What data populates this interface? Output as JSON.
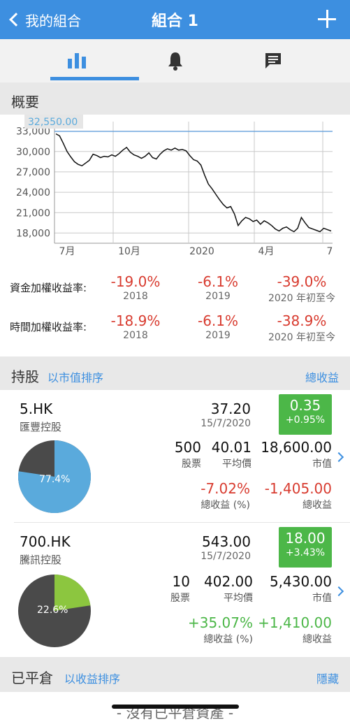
{
  "header": {
    "back_label": "我的組合",
    "title": "組合 1",
    "add_icon": "plus-icon",
    "background": "#3d8fe0"
  },
  "tabs": [
    {
      "icon": "bar-chart-icon",
      "active": true
    },
    {
      "icon": "bell-icon",
      "active": false
    },
    {
      "icon": "message-icon",
      "active": false
    }
  ],
  "overview": {
    "title": "概要"
  },
  "chart_data": {
    "type": "line",
    "title": "",
    "highlight_label": "32,550.00",
    "y_ticks": [
      "33,000",
      "30,000",
      "27,000",
      "24,000",
      "21,000",
      "18,000"
    ],
    "ylim": [
      16500,
      34400
    ],
    "x_ticks": [
      "7月",
      "10月",
      "2020",
      "4月",
      "7"
    ],
    "grid": true,
    "series": [
      {
        "points": [
          [
            0,
            32600
          ],
          [
            3,
            32300
          ],
          [
            6,
            31200
          ],
          [
            9,
            30000
          ],
          [
            12,
            29200
          ],
          [
            15,
            28500
          ],
          [
            18,
            28100
          ],
          [
            21,
            27900
          ],
          [
            24,
            28300
          ],
          [
            27,
            28700
          ],
          [
            30,
            29600
          ],
          [
            33,
            29400
          ],
          [
            36,
            29100
          ],
          [
            39,
            29300
          ],
          [
            42,
            29200
          ],
          [
            45,
            29500
          ],
          [
            48,
            29300
          ],
          [
            51,
            29700
          ],
          [
            54,
            30200
          ],
          [
            57,
            30600
          ],
          [
            60,
            29900
          ],
          [
            63,
            29500
          ],
          [
            66,
            29300
          ],
          [
            69,
            29000
          ],
          [
            72,
            29300
          ],
          [
            75,
            29800
          ],
          [
            78,
            29100
          ],
          [
            81,
            28900
          ],
          [
            84,
            29600
          ],
          [
            87,
            30100
          ],
          [
            90,
            30400
          ],
          [
            93,
            30200
          ],
          [
            96,
            30500
          ],
          [
            99,
            30200
          ],
          [
            102,
            30300
          ],
          [
            105,
            30100
          ],
          [
            108,
            29400
          ],
          [
            111,
            28800
          ],
          [
            114,
            28600
          ],
          [
            117,
            28000
          ],
          [
            120,
            26500
          ],
          [
            123,
            25200
          ],
          [
            126,
            24500
          ],
          [
            129,
            23700
          ],
          [
            132,
            22900
          ],
          [
            135,
            22200
          ],
          [
            138,
            21700
          ],
          [
            141,
            21900
          ],
          [
            144,
            20800
          ],
          [
            147,
            19100
          ],
          [
            150,
            19800
          ],
          [
            153,
            20300
          ],
          [
            156,
            20100
          ],
          [
            159,
            19700
          ],
          [
            162,
            19900
          ],
          [
            165,
            19300
          ],
          [
            168,
            19800
          ],
          [
            171,
            19500
          ],
          [
            174,
            19100
          ],
          [
            177,
            18600
          ],
          [
            180,
            18300
          ],
          [
            183,
            18700
          ],
          [
            186,
            18900
          ],
          [
            189,
            18500
          ],
          [
            192,
            18200
          ],
          [
            195,
            18700
          ],
          [
            198,
            20300
          ],
          [
            201,
            19500
          ],
          [
            204,
            18800
          ],
          [
            207,
            18600
          ],
          [
            210,
            18400
          ],
          [
            213,
            18200
          ],
          [
            216,
            18700
          ],
          [
            219,
            18500
          ],
          [
            222,
            18300
          ]
        ]
      }
    ]
  },
  "returns": {
    "rows": [
      {
        "label": "資金加權收益率:",
        "values": [
          "-19.0%",
          "-6.1%",
          "-39.0%"
        ]
      },
      {
        "label": "時間加權收益率:",
        "values": [
          "-18.9%",
          "-6.1%",
          "-38.9%"
        ]
      }
    ],
    "years": [
      "2018",
      "2019",
      "2020 年初至今"
    ]
  },
  "holdings": {
    "title": "持股",
    "sort_label": "以市值排序",
    "right_label": "總收益",
    "items": [
      {
        "symbol": "5.HK",
        "name": "匯豐控股",
        "price": "37.20",
        "date": "15/7/2020",
        "change": "0.35",
        "change_pct": "+0.95%",
        "shares": "500",
        "shares_label": "股票",
        "avg_price": "40.01",
        "avg_label": "平均價",
        "market_value": "18,600.00",
        "mv_label": "市值",
        "pl_pct": "-7.02%",
        "pl_pct_label": "總收益 (%)",
        "pl": "-1,405.00",
        "pl_label": "總收益",
        "pie_pct": "77.4%",
        "pie_value": 0.774,
        "pie_color": "#5aaadc",
        "pl_color": "red"
      },
      {
        "symbol": "700.HK",
        "name": "騰訊控股",
        "price": "543.00",
        "date": "15/7/2020",
        "change": "18.00",
        "change_pct": "+3.43%",
        "shares": "10",
        "shares_label": "股票",
        "avg_price": "402.00",
        "avg_label": "平均價",
        "market_value": "5,430.00",
        "mv_label": "市值",
        "pl_pct": "+35.07%",
        "pl_pct_label": "總收益 (%)",
        "pl": "+1,410.00",
        "pl_label": "總收益",
        "pie_pct": "22.6%",
        "pie_value": 0.226,
        "pie_color": "#8cc63f",
        "pl_color": "green"
      }
    ]
  },
  "closed": {
    "title": "已平倉",
    "sort_label": "以收益排序",
    "right_label": "隱藏",
    "empty_text": "- 沒有已平倉資產 -"
  }
}
